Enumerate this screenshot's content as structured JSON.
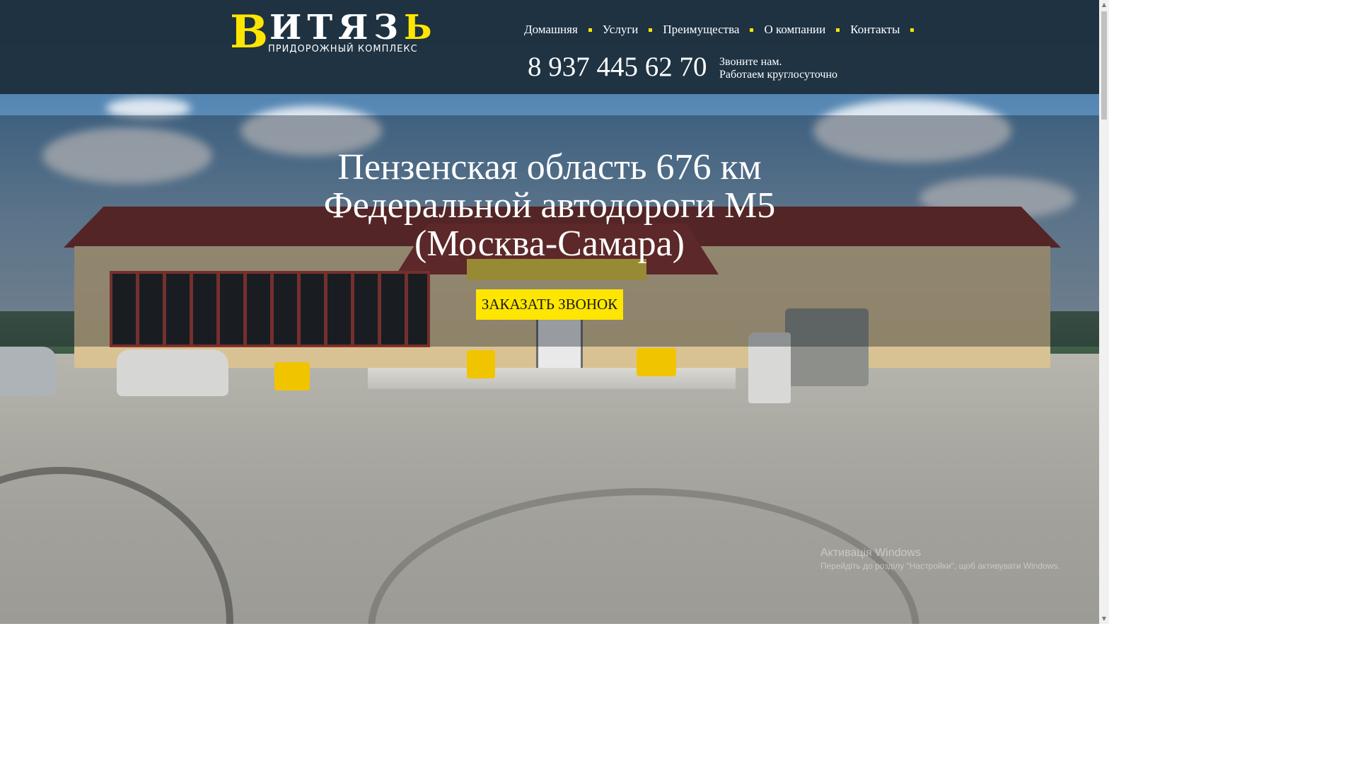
{
  "logo": {
    "mark": "В",
    "word": "ИТЯЗ",
    "word_end": "Ь",
    "subtitle": "ПРИДОРОЖНЫЙ КОМПЛЕКС"
  },
  "nav": {
    "items": [
      {
        "label": "Домашняя"
      },
      {
        "label": "Услуги"
      },
      {
        "label": "Преимущества"
      },
      {
        "label": "О компании"
      },
      {
        "label": "Контакты"
      }
    ]
  },
  "contact": {
    "phone": "8 937 445 62 70",
    "note_line1": "Звоните нам.",
    "note_line2": "Работаем круглосуточно"
  },
  "hero": {
    "title_line1": "Пензенская область 676 км",
    "title_line2": "Федеральной автодороги М5",
    "title_line3": "(Москва-Самара)",
    "cta_label": "ЗАКАЗАТЬ ЗВОНОК"
  },
  "watermark": {
    "title": "Активація Windows",
    "subtitle": "Перейдіть до розділу \"Настройки\", щоб активувати Windows."
  },
  "colors": {
    "accent": "#ffe600",
    "header_bg": "#1c2d3a",
    "text": "#ffffff"
  },
  "icons": {
    "scroll_up": "chevron-up-icon",
    "scroll_down": "chevron-down-icon"
  }
}
